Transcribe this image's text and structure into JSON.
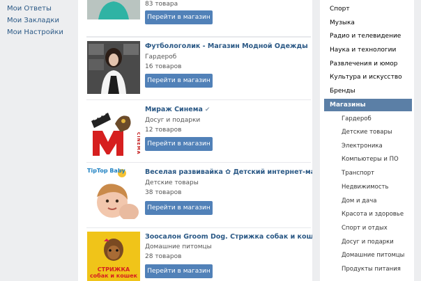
{
  "left_nav": {
    "items": [
      {
        "label": "Мои Ответы"
      },
      {
        "label": "Мои Закладки"
      },
      {
        "label": "Мои Настройки"
      }
    ]
  },
  "shops": [
    {
      "name": "",
      "category": "",
      "count": "83 товара",
      "button": "Перейти в магазин"
    },
    {
      "name": "Футбологолик - Магазин Модной Одежды",
      "category": "Гардероб",
      "count": "16 товаров",
      "button": "Перейти в магазин"
    },
    {
      "name": "Мираж Синема",
      "verified_icon": "check-icon",
      "category": "Досуг и подарки",
      "count": "12 товаров",
      "button": "Перейти в магазин",
      "logo_text": "CINEMA"
    },
    {
      "name": "Веселая развивайка ✿ Детский интернет-магазин",
      "category": "Детские товары",
      "count": "38 товаров",
      "button": "Перейти в магазин",
      "logo_text": "TipTop Baby"
    },
    {
      "name": "Зоосалон Groom Dog. Стрижка собак и кошек.",
      "category": "Домашние питомцы",
      "count": "28 товаров",
      "button": "Перейти в магазин",
      "logo_text": "СТРИЖКА собак и кошек"
    }
  ],
  "categories": {
    "top_items": [
      {
        "label": "Спорт"
      },
      {
        "label": "Музыка"
      },
      {
        "label": "Радио и телевидение"
      },
      {
        "label": "Наука и технологии"
      },
      {
        "label": "Развлечения и юмор"
      },
      {
        "label": "Культура и искусство"
      },
      {
        "label": "Бренды"
      }
    ],
    "selected": {
      "label": "Магазины"
    },
    "sub_items": [
      {
        "label": "Гардероб"
      },
      {
        "label": "Детские товары"
      },
      {
        "label": "Электроника"
      },
      {
        "label": "Компьютеры и ПО"
      },
      {
        "label": "Транспорт"
      },
      {
        "label": "Недвижимость"
      },
      {
        "label": "Дом и дача"
      },
      {
        "label": "Красота и здоровье"
      },
      {
        "label": "Спорт и отдых"
      },
      {
        "label": "Досуг и подарки"
      },
      {
        "label": "Домашние питомцы"
      },
      {
        "label": "Продукты питания"
      }
    ]
  },
  "colors": {
    "link": "#2a5885",
    "button": "#5181b8",
    "selected": "#5b7fa6",
    "background": "#edeef0"
  }
}
